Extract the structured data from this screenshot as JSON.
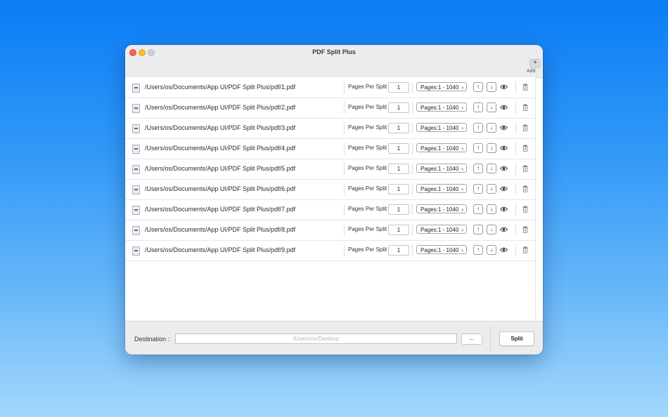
{
  "window": {
    "title": "PDF Split Plus"
  },
  "toolbar": {
    "add_symbol": "+",
    "add_label": "Add"
  },
  "row_labels": {
    "pages_per_split": "Pages Per Split"
  },
  "rows": [
    {
      "path": "/Users/os/Documents/App UI/PDF Split Plus/pdf/1.pdf",
      "pages_per_split": "1",
      "pages": "Pages:1 - 1040"
    },
    {
      "path": "/Users/os/Documents/App UI/PDF Split Plus/pdf/2.pdf",
      "pages_per_split": "1",
      "pages": "Pages:1 - 1040"
    },
    {
      "path": "/Users/os/Documents/App UI/PDF Split Plus/pdf/3.pdf",
      "pages_per_split": "1",
      "pages": "Pages:1 - 1040"
    },
    {
      "path": "/Users/os/Documents/App UI/PDF Split Plus/pdf/4.pdf",
      "pages_per_split": "1",
      "pages": "Pages:1 - 1040"
    },
    {
      "path": "/Users/os/Documents/App UI/PDF Split Plus/pdf/5.pdf",
      "pages_per_split": "1",
      "pages": "Pages:1 - 1040"
    },
    {
      "path": "/Users/os/Documents/App UI/PDF Split Plus/pdf/6.pdf",
      "pages_per_split": "1",
      "pages": "Pages:1 - 1040"
    },
    {
      "path": "/Users/os/Documents/App UI/PDF Split Plus/pdf/7.pdf",
      "pages_per_split": "1",
      "pages": "Pages:1 - 1040"
    },
    {
      "path": "/Users/os/Documents/App UI/PDF Split Plus/pdf/8.pdf",
      "pages_per_split": "1",
      "pages": "Pages:1 - 1040"
    },
    {
      "path": "/Users/os/Documents/App UI/PDF Split Plus/pdf/9.pdf",
      "pages_per_split": "1",
      "pages": "Pages:1 - 1040"
    }
  ],
  "icons": {
    "file": "pdf-file-icon",
    "move_up": "arrow-up-icon",
    "move_down": "arrow-down-icon",
    "preview": "eye-icon",
    "delete": "trash-icon"
  },
  "glyphs": {
    "chevron": "›",
    "up": "↑",
    "down": "↓"
  },
  "footer": {
    "destination_label": "Destination :",
    "destination_placeholder": "/Users/os/Desktop",
    "browse_label": "...",
    "split_label": "Split"
  },
  "colors": {
    "close": "#fe5f57",
    "minimize": "#febc2e",
    "zoom": "#cfcfcf"
  }
}
